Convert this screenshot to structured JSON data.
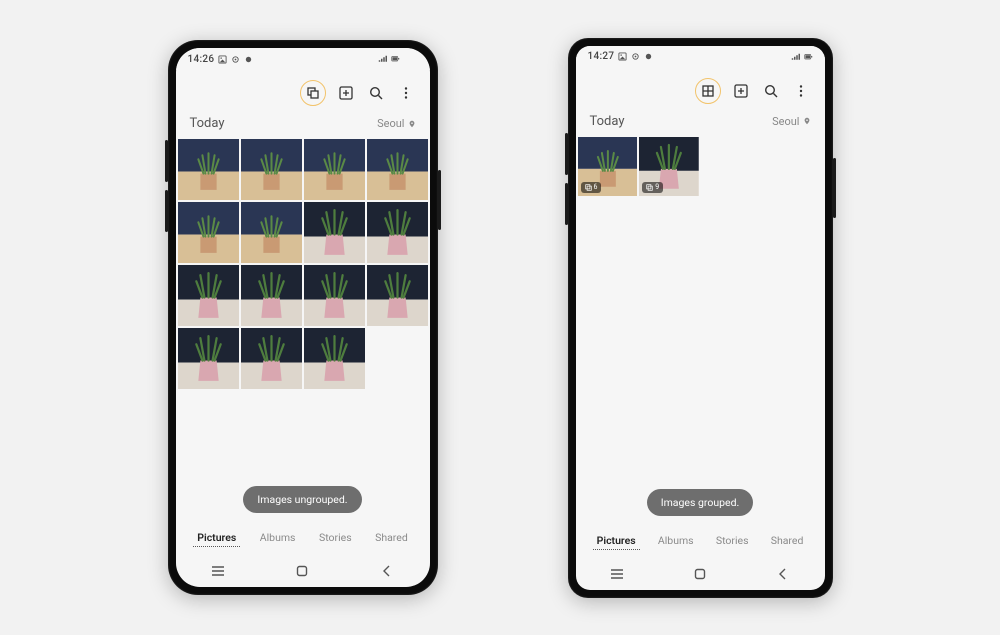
{
  "phoneA": {
    "status": {
      "time": "14:26"
    },
    "section": {
      "title": "Today",
      "location": "Seoul"
    },
    "thumbnails": [
      {
        "variant": "blue-tan"
      },
      {
        "variant": "blue-tan"
      },
      {
        "variant": "blue-tan"
      },
      {
        "variant": "blue-tan"
      },
      {
        "variant": "blue-tan"
      },
      {
        "variant": "blue-tan"
      },
      {
        "variant": "pink-dark"
      },
      {
        "variant": "pink-dark"
      },
      {
        "variant": "pink-dark"
      },
      {
        "variant": "pink-dark"
      },
      {
        "variant": "pink-dark"
      },
      {
        "variant": "pink-dark"
      },
      {
        "variant": "pink-dark"
      },
      {
        "variant": "pink-dark"
      },
      {
        "variant": "pink-dark"
      }
    ],
    "toast": "Images ungrouped.",
    "tabs": [
      "Pictures",
      "Albums",
      "Stories",
      "Shared"
    ],
    "active_tab_index": 0
  },
  "phoneB": {
    "status": {
      "time": "14:27"
    },
    "section": {
      "title": "Today",
      "location": "Seoul"
    },
    "thumbnails": [
      {
        "variant": "blue-tan",
        "badge_count": "6"
      },
      {
        "variant": "pink-dark",
        "badge_count": "9"
      }
    ],
    "toast": "Images grouped.",
    "tabs": [
      "Pictures",
      "Albums",
      "Stories",
      "Shared"
    ],
    "active_tab_index": 0
  }
}
